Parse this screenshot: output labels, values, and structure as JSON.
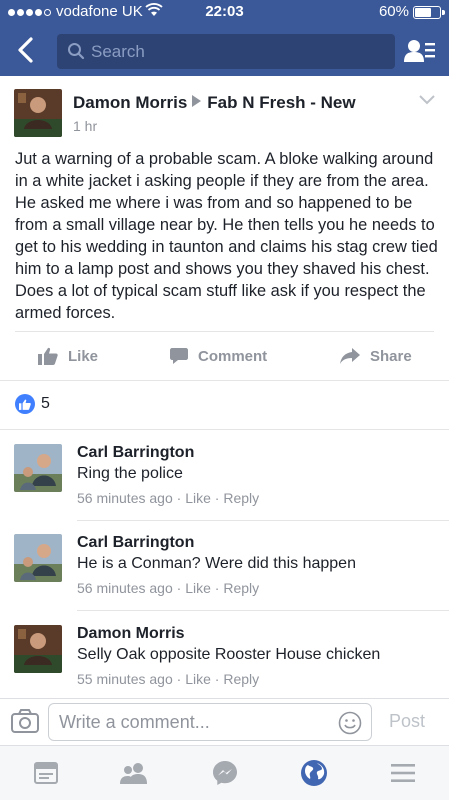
{
  "status_bar": {
    "carrier": "vodafone UK",
    "time": "22:03",
    "battery": "60%",
    "battery_level": 0.6,
    "signal_bars": 4
  },
  "nav": {
    "search_placeholder": "Search",
    "icons": {
      "back": "back-chevron-icon",
      "search": "search-icon",
      "friends": "friends-list-icon"
    }
  },
  "post": {
    "author": "Damon Morris",
    "group": "Fab N Fresh - New",
    "time": "1 hr",
    "text": "Jut a warning of a probable scam. A bloke walking around in a white jacket i asking people if they are from the area. He asked me where i was from and so happened to be from a small village near by. He then tells you he needs to get to his wedding in taunton and claims his stag crew tied him to a lamp post and shows you they shaved his chest. Does a lot of typical scam stuff like ask if you respect the armed forces.",
    "actions": {
      "like": "Like",
      "comment": "Comment",
      "share": "Share"
    },
    "reaction_count": "5"
  },
  "comments": [
    {
      "name": "Carl Barrington",
      "text": "Ring the police",
      "time": "56 minutes ago",
      "like": "Like",
      "reply": "Reply"
    },
    {
      "name": "Carl Barrington",
      "text": "He is a Conman? Were did this happen",
      "time": "56 minutes ago",
      "like": "Like",
      "reply": "Reply"
    },
    {
      "name": "Damon Morris",
      "text": "Selly Oak opposite Rooster House chicken",
      "time": "55 minutes ago",
      "like": "Like",
      "reply": "Reply"
    }
  ],
  "composer": {
    "placeholder": "Write a comment...",
    "post_label": "Post"
  },
  "tabbar": {
    "icons": [
      "news-feed-icon",
      "friends-icon",
      "messenger-icon",
      "globe-notifications-icon",
      "menu-icon"
    ],
    "active_index": 3
  },
  "colors": {
    "brand": "#3b5998",
    "search_bg": "#2d4373",
    "meta_gray": "#90949c",
    "like_blue": "#4080ff",
    "active_tab": "#4267b2"
  }
}
